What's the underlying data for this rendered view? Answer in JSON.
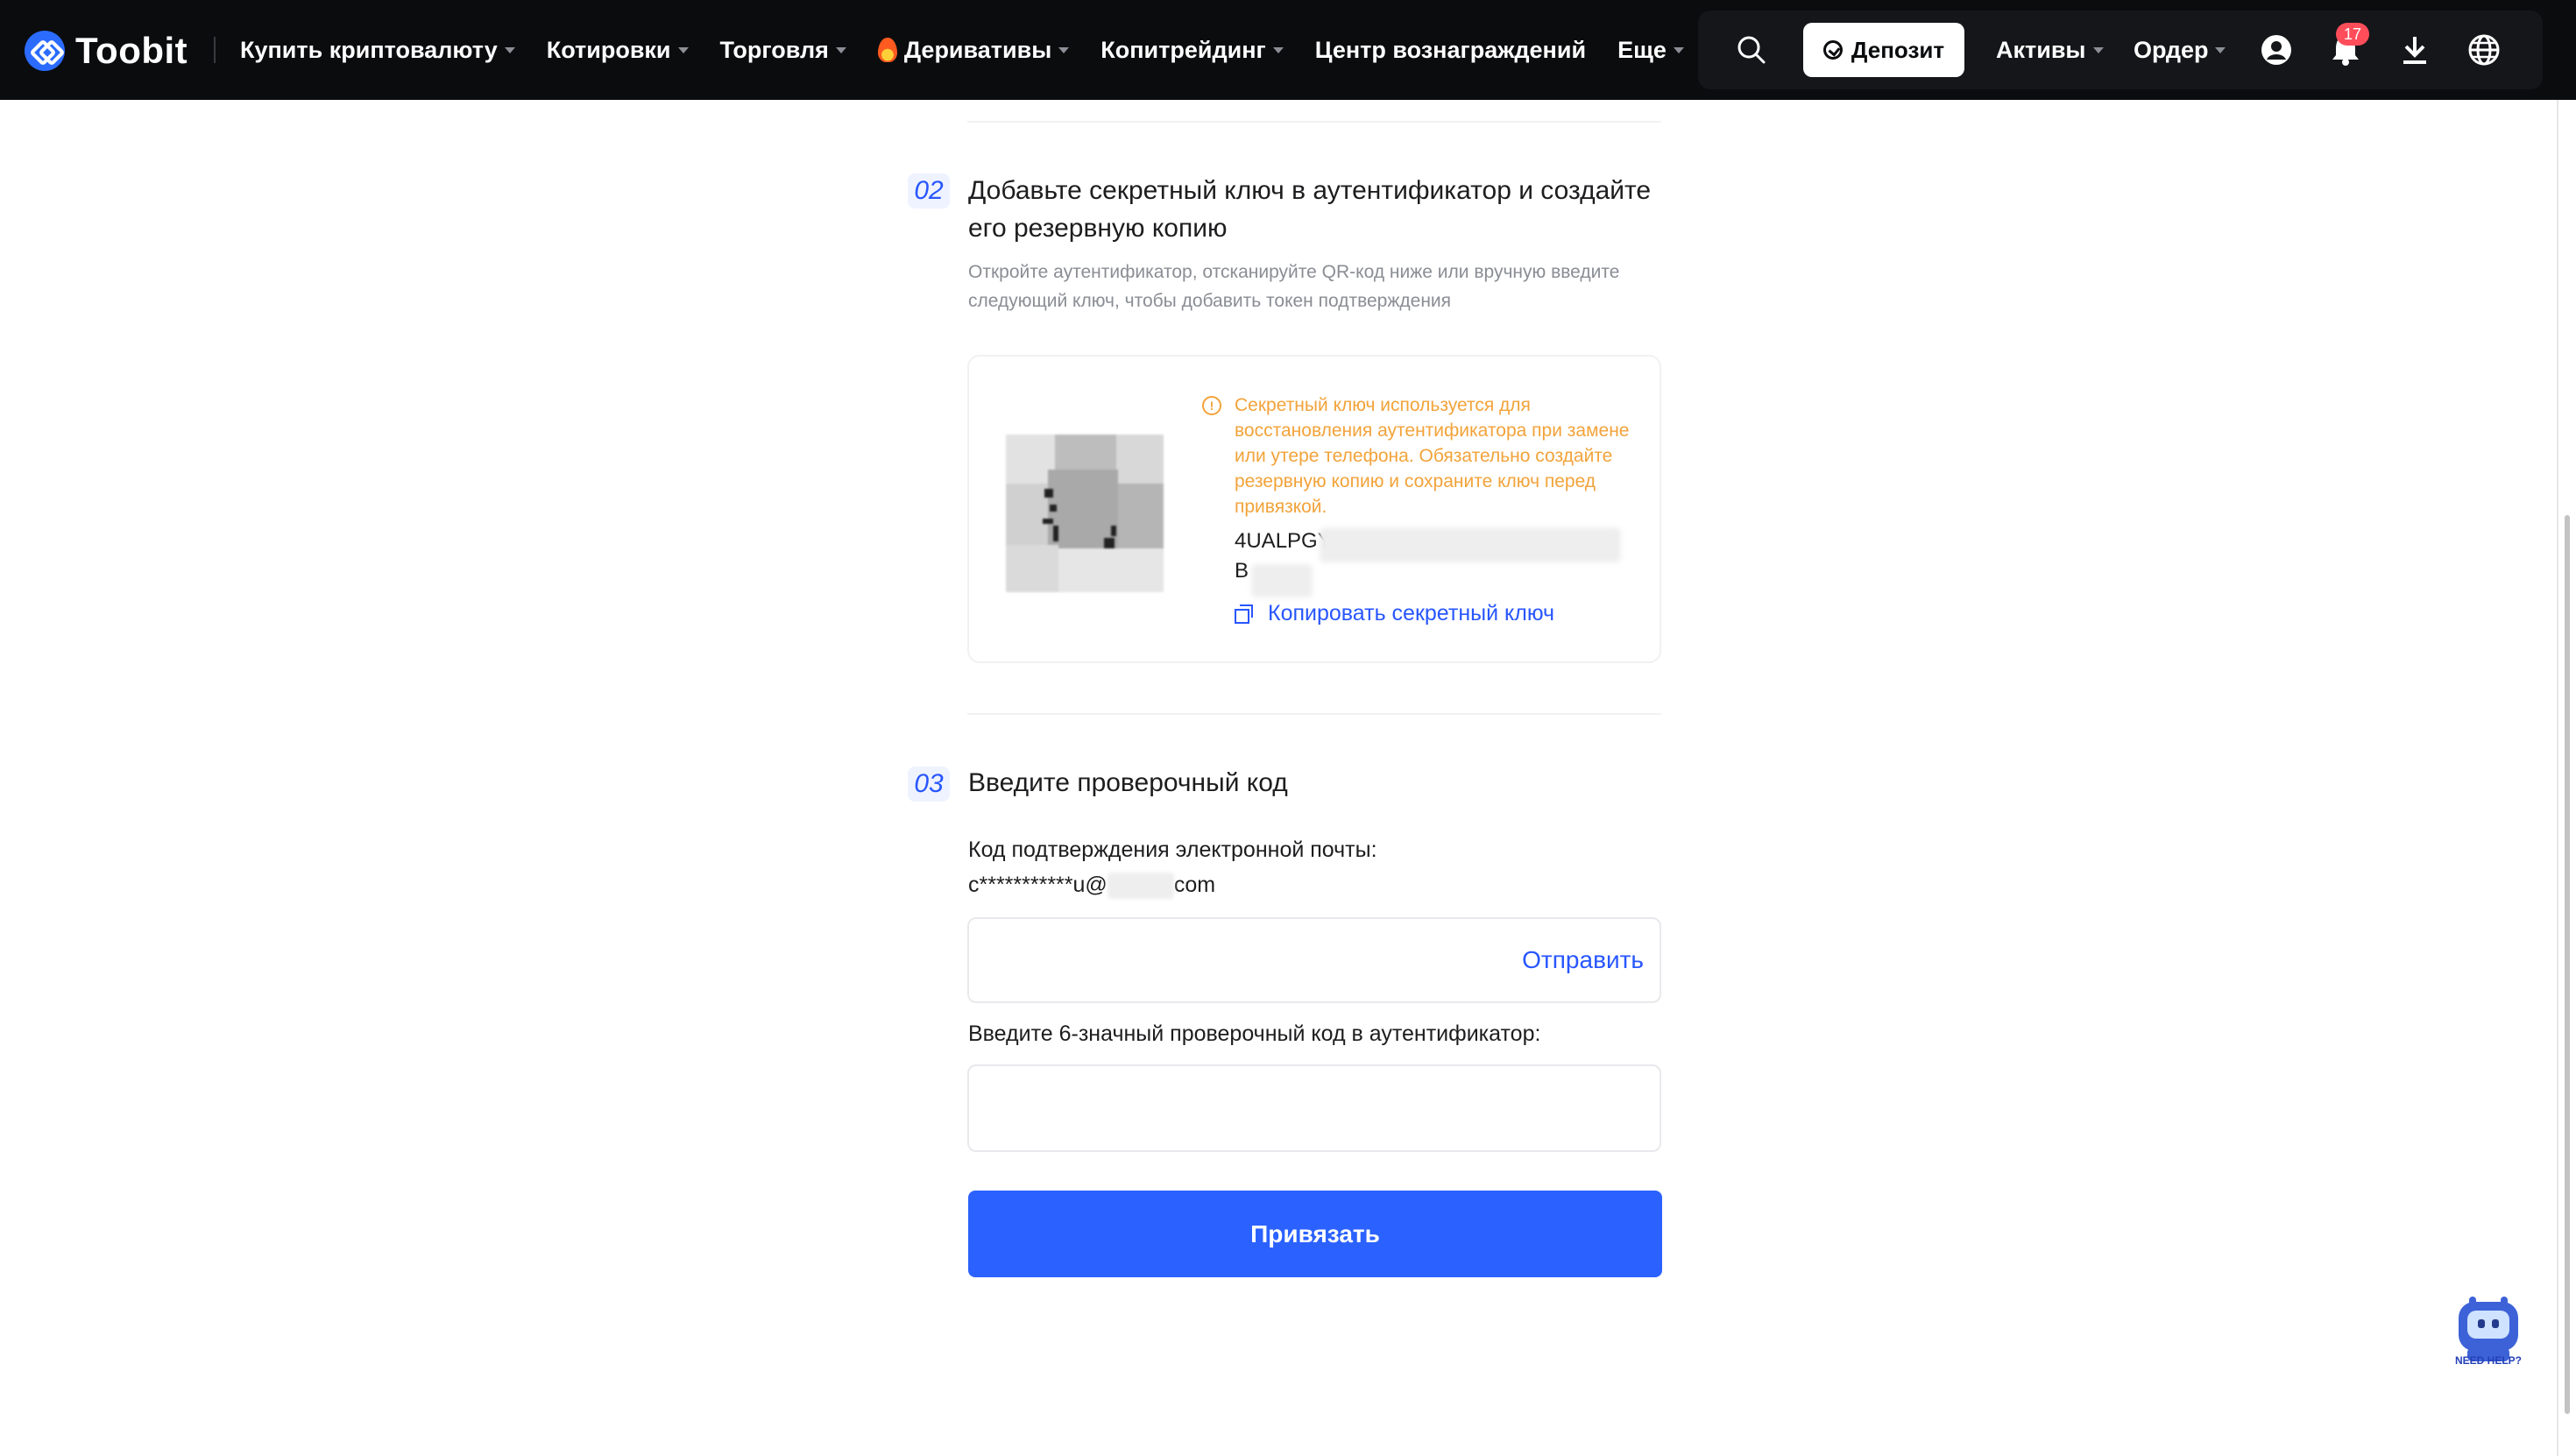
{
  "header": {
    "logo_text": "Toobit",
    "nav": [
      {
        "label": "Купить криптовалюту",
        "caret": true
      },
      {
        "label": "Котировки",
        "caret": true
      },
      {
        "label": "Торговля",
        "caret": true
      },
      {
        "label": "Деривативы",
        "caret": true,
        "icon": "fire-icon"
      },
      {
        "label": "Копитрейдинг",
        "caret": true
      },
      {
        "label": "Центр вознаграждений",
        "caret": false
      },
      {
        "label": "Еще",
        "caret": true
      }
    ],
    "deposit_label": "Депозит",
    "assets_label": "Активы",
    "orders_label": "Ордер",
    "notification_count": "17"
  },
  "step2": {
    "number": "02",
    "title": "Добавьте секретный ключ в аутентификатор и создайте его резервную копию",
    "description": "Откройте аутентификатор, отсканируйте QR-код ниже или вручную введите следующий ключ, чтобы добавить токен подтверждения",
    "warning": "Секретный ключ используется для восстановления аутентификатора при замене или утере телефона. Обязательно создайте резервную копию и сохраните ключ перед привязкой.",
    "secret_line1": "4UALPGY",
    "secret_line2": "B",
    "copy_label": "Копировать секретный ключ"
  },
  "step3": {
    "number": "03",
    "title": "Введите проверочный код",
    "email_label": "Код подтверждения электронной почты:",
    "email_prefix": "c***********u@",
    "email_suffix": "com",
    "send_label": "Отправить",
    "auth_label": "Введите 6-значный проверочный код в аутентификатор:",
    "email_code_value": "",
    "auth_code_value": "",
    "submit_label": "Привязать"
  },
  "help": {
    "label": "NEED HELP?"
  },
  "colors": {
    "accent": "#2b62ff",
    "link": "#2856ff",
    "warning": "#f2a33a",
    "header_bg": "#0b0c0e",
    "badge": "#ff4d5a"
  }
}
